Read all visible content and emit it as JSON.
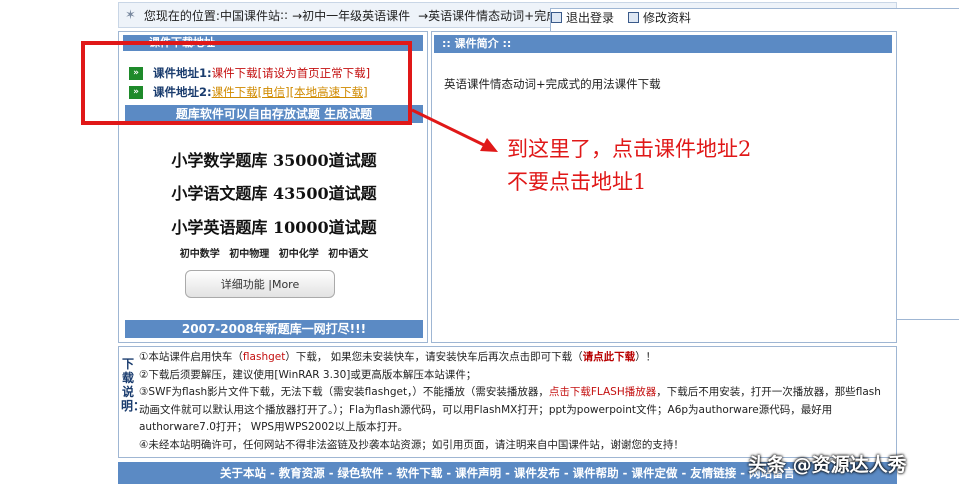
{
  "breadcrumb": {
    "prefix": "您现在的位置:",
    "site": "中国课件站",
    "sep1": "::",
    "level1": "→初中一年级英语课件",
    "level2": "→英语课件情态动词+完成式的用法",
    "logout": "退出登录",
    "edit": "修改资料"
  },
  "left_panel": {
    "header": "课件下载地址",
    "addr1_label": "课件地址1:",
    "addr1_link": "课件下载[请设为首页正常下载]",
    "addr2_label": "课件地址2:",
    "addr2_link": "课件下载[电信][本地高速下载]",
    "banner_top": "题库软件可以自由存放试题 生成试题",
    "ad_line1": "小学数学题库  35000道试题",
    "ad_line2": "小学语文题库  43500道试题",
    "ad_line3": "小学英语题库  10000道试题",
    "ad_small": "初中数学 初中物理 初中化学 初中语文",
    "more_button": "详细功能 |More",
    "banner_bottom": "2007-2008年新题库一网打尽!!!"
  },
  "right_panel": {
    "header": ":: 课件简介 ::",
    "description": "英语课件情态动词+完成式的用法课件下载"
  },
  "annotation": {
    "line1": "到这里了，点击课件地址2",
    "line2": "不要点击地址1",
    "color": "#e01818"
  },
  "notes": {
    "label": "下载说明：",
    "n1_a": "①本站课件启用快车（",
    "n1_b": "flashget",
    "n1_c": "）下载，  如果您未安装快车，请安装快车后再次点击即可下载（",
    "n1_d": "请点此下载",
    "n1_e": "）！",
    "n2": "②下载后须要解压，建议使用[WinRAR 3.30]或更高版本解压本站课件；",
    "n3_a": "③SWF为flash影片文件下载，无法下载（需安装flashget，）不能播放（需安装播放器，",
    "n3_b": "点击下载FLASH播放器",
    "n3_c": "，下载后不用安装，打开一次播放器，那些flash动画文件就可以默认用这个播放器打开了。）；Fla为flash源代码，可以用FlashMX打开；ppt为powerpoint文件；A6p为authorware源代码，最好用authorware7.0打开；  WPS用WPS2002以上版本打开。",
    "n4": "④未经本站明确许可，任何网站不得非法盗链及抄袭本站资源；如引用页面，请注明来自中国课件站，谢谢您的支持！"
  },
  "footer": {
    "links": "关于本站 - 教育资源 - 绿色软件 - 软件下载 - 课件声明 - 课件发布 - 课件帮助 - 课件定做 - 友情链接 - 网站留言"
  },
  "watermark": "头条 @资源达人秀",
  "colors": {
    "bar": "#5b8ac4",
    "accent_red": "#e01818"
  }
}
